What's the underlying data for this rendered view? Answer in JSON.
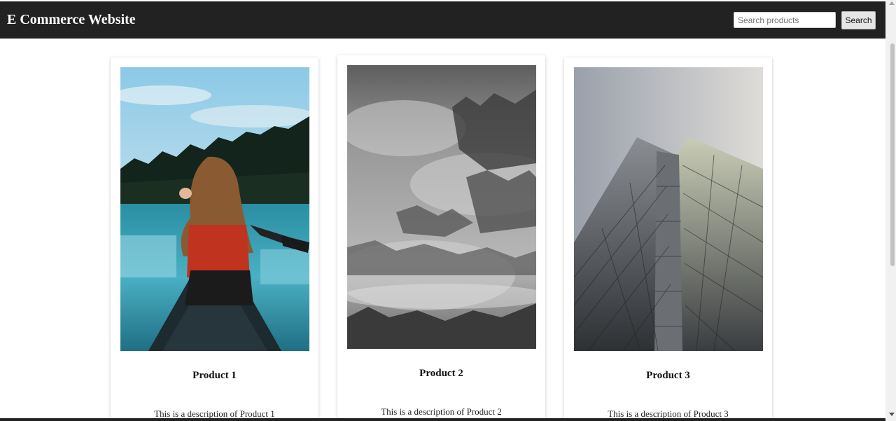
{
  "header": {
    "title": "E Commerce Website",
    "search_placeholder": "Search products",
    "search_value": "",
    "search_button_label": "Search"
  },
  "products": [
    {
      "title": "Product 1",
      "description": "This is a description of Product 1",
      "image_subject": "woman paddling canoe on lake"
    },
    {
      "title": "Product 2",
      "description": "This is a description of Product 2",
      "image_subject": "misty forest in grayscale"
    },
    {
      "title": "Product 3",
      "description": "This is a description of Product 3",
      "image_subject": "skyscraper viewed from below"
    }
  ],
  "colors": {
    "header_bg": "#222222",
    "header_text": "#ffffff",
    "page_bg": "#ffffff"
  }
}
